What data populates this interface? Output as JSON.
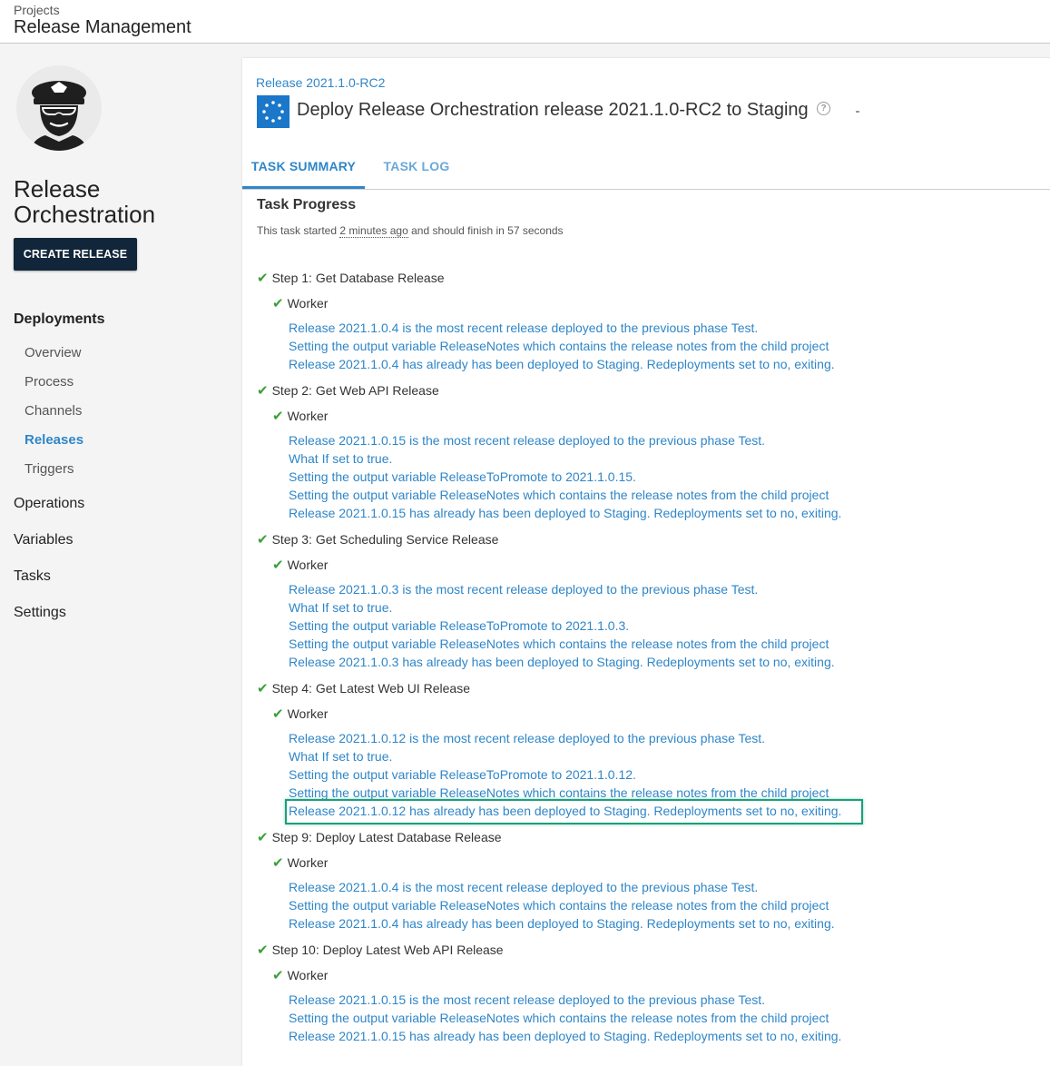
{
  "header": {
    "crumb": "Projects",
    "title": "Release Management"
  },
  "sidebar": {
    "project_name": "Release Orchestration",
    "create_release": "CREATE RELEASE",
    "nav": {
      "deployments": "Deployments",
      "overview": "Overview",
      "process": "Process",
      "channels": "Channels",
      "releases": "Releases",
      "triggers": "Triggers",
      "operations": "Operations",
      "variables": "Variables",
      "tasks": "Tasks",
      "settings": "Settings"
    }
  },
  "task": {
    "release_link": "Release 2021.1.0-RC2",
    "title": "Deploy Release Orchestration release 2021.1.0-RC2 to Staging",
    "help": "?",
    "tabs": [
      "TASK SUMMARY",
      "TASK LOG"
    ],
    "progress_title": "Task Progress",
    "meta": {
      "prefix": "This task started ",
      "started": "2 minutes ago",
      "suffix": " and should finish in 57 seconds"
    },
    "worker_label": "Worker",
    "steps": [
      {
        "title": "Step 1: Get Database Release",
        "messages": [
          "Release 2021.1.0.4 is the most recent release deployed to the previous phase Test.",
          "Setting the output variable ReleaseNotes which contains the release notes from the child project",
          "Release 2021.1.0.4 has already has been deployed to Staging. Redeployments set to no, exiting."
        ]
      },
      {
        "title": "Step 2: Get Web API Release",
        "messages": [
          "Release 2021.1.0.15 is the most recent release deployed to the previous phase Test.",
          "What If set to true.",
          "Setting the output variable ReleaseToPromote to 2021.1.0.15.",
          "Setting the output variable ReleaseNotes which contains the release notes from the child project",
          "Release 2021.1.0.15 has already has been deployed to Staging. Redeployments set to no, exiting."
        ]
      },
      {
        "title": "Step 3: Get Scheduling Service Release",
        "messages": [
          "Release 2021.1.0.3 is the most recent release deployed to the previous phase Test.",
          "What If set to true.",
          "Setting the output variable ReleaseToPromote to 2021.1.0.3.",
          "Setting the output variable ReleaseNotes which contains the release notes from the child project",
          "Release 2021.1.0.3 has already has been deployed to Staging. Redeployments set to no, exiting."
        ]
      },
      {
        "title": "Step 4: Get Latest Web UI Release",
        "messages": [
          "Release 2021.1.0.12 is the most recent release deployed to the previous phase Test.",
          "What If set to true.",
          "Setting the output variable ReleaseToPromote to 2021.1.0.12.",
          "Setting the output variable ReleaseNotes which contains the release notes from the child project",
          "Release 2021.1.0.12 has already has been deployed to Staging. Redeployments set to no, exiting."
        ]
      },
      {
        "title": "Step 9: Deploy Latest Database Release",
        "messages": [
          "Release 2021.1.0.4 is the most recent release deployed to the previous phase Test.",
          "Setting the output variable ReleaseNotes which contains the release notes from the child project",
          "Release 2021.1.0.4 has already has been deployed to Staging. Redeployments set to no, exiting."
        ]
      },
      {
        "title": "Step 10: Deploy Latest Web API Release",
        "messages": [
          "Release 2021.1.0.15 is the most recent release deployed to the previous phase Test.",
          "Setting the output variable ReleaseNotes which contains the release notes from the child project",
          "Release 2021.1.0.15 has already has been deployed to Staging. Redeployments set to no, exiting."
        ]
      }
    ]
  },
  "colors": {
    "accent": "#2f86c8",
    "success": "#3aa03a",
    "highlight": "#1aa07a",
    "button": "#11263a"
  }
}
